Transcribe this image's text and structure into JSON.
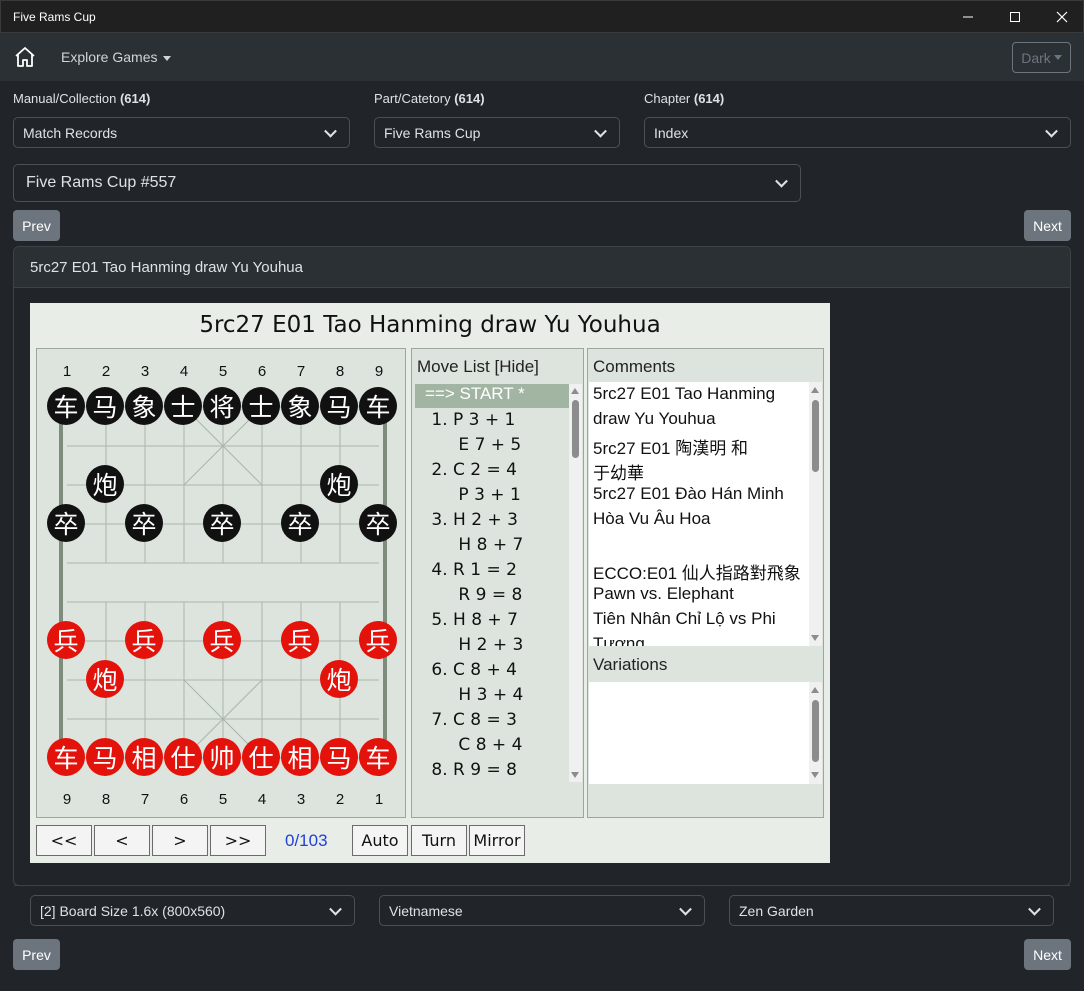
{
  "window": {
    "title": "Five Rams Cup"
  },
  "navbar": {
    "explore_label": "Explore Games",
    "theme_label": "Dark"
  },
  "filters": {
    "manual_label": "Manual/Collection",
    "manual_count": "(614)",
    "manual_value": "Match Records",
    "part_label": "Part/Catetory",
    "part_count": "(614)",
    "part_value": "Five Rams Cup",
    "chapter_label": "Chapter",
    "chapter_count": "(614)",
    "chapter_value": "Index",
    "game_value": "Five Rams Cup #557"
  },
  "nav": {
    "prev_label": "Prev",
    "next_label": "Next"
  },
  "card": {
    "header": "5rc27 E01 Tao Hanming draw Yu Youhua"
  },
  "game": {
    "title": "5rc27 E01 Tao Hanming draw Yu Youhua",
    "top_numbers": [
      "1",
      "2",
      "3",
      "4",
      "5",
      "6",
      "7",
      "8",
      "9"
    ],
    "bottom_numbers": [
      "9",
      "8",
      "7",
      "6",
      "5",
      "4",
      "3",
      "2",
      "1"
    ],
    "pieces": {
      "black_back": [
        "车",
        "马",
        "象",
        "士",
        "将",
        "士",
        "象",
        "马",
        "车"
      ],
      "black_cannon": "炮",
      "black_soldier": "卒",
      "red_back": [
        "车",
        "马",
        "相",
        "仕",
        "帅",
        "仕",
        "相",
        "马",
        "车"
      ],
      "red_cannon": "炮",
      "red_soldier": "兵"
    },
    "movelist_title": "Move List [Hide]",
    "move_start": "==> START *",
    "moves": [
      " 1. P 3 + 1",
      "      E 7 + 5",
      " 2. C 2 = 4",
      "      P 3 + 1",
      " 3. H 2 + 3",
      "      H 8 + 7",
      " 4. R 1 = 2",
      "      R 9 = 8",
      " 5. H 8 + 7",
      "      H 2 + 3",
      " 6. C 8 + 4",
      "      H 3 + 4",
      " 7. C 8 = 3",
      "      C 8 + 4",
      " 8. R 9 = 8"
    ],
    "comments_title": "Comments",
    "comments": [
      "5rc27 E01 Tao Hanming",
      "draw Yu Youhua",
      "5rc27 E01 陶漢明 和",
      "于幼華",
      "5rc27 E01 Đào Hán Minh",
      "Hòa Vu Âu Hoa",
      "",
      "ECCO:E01 仙人指路對飛象",
      "Pawn vs. Elephant",
      "Tiên Nhân Chỉ Lộ vs Phi",
      "Tượng"
    ],
    "variations_title": "Variations",
    "controls": {
      "first": "<<",
      "prev": "<",
      "next": ">",
      "last": ">>",
      "counter": "0/103",
      "auto": "Auto",
      "turn": "Turn",
      "mirror": "Mirror"
    }
  },
  "footer": {
    "board_size": "[2] Board Size 1.6x (800x560)",
    "language": "Vietnamese",
    "theme": "Zen Garden"
  }
}
